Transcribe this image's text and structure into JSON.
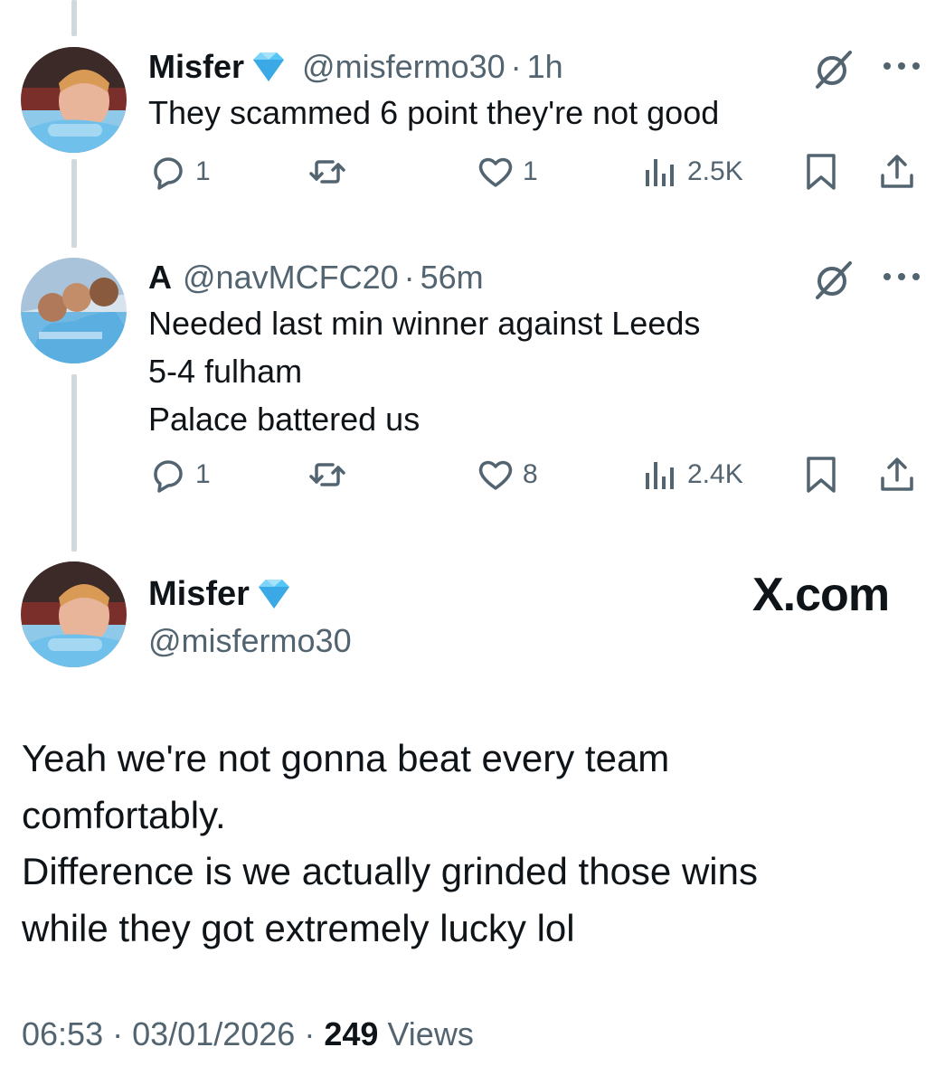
{
  "replies": [
    {
      "display_name": "Misfer",
      "verified_icon": "blue-diamond-emoji",
      "handle": "@misfermo30",
      "time": "1h",
      "text_lines": [
        "They scammed 6 point they're not good"
      ],
      "replies_count": "1",
      "reposts_count": "",
      "likes_count": "1",
      "views_count": "2.5K"
    },
    {
      "display_name": "A",
      "handle": "@navMCFC20",
      "time": "56m",
      "text_lines": [
        "Needed last min winner against Leeds",
        "5-4 fulham",
        "Palace battered us"
      ],
      "replies_count": "1",
      "reposts_count": "",
      "likes_count": "8",
      "views_count": "2.4K"
    }
  ],
  "main_post": {
    "display_name": "Misfer",
    "verified_icon": "blue-diamond-emoji",
    "handle": "@misfermo30",
    "watermark": "X.com",
    "text_lines": [
      "Yeah we're not gonna beat every team",
      "comfortably.",
      "Difference is we actually grinded those wins",
      "while they got extremely lucky lol"
    ],
    "time": "06:53",
    "date": "03/01/2026",
    "views_count": "249",
    "views_label": "Views",
    "separator": "·"
  },
  "colors": {
    "text": "#0f1419",
    "secondary": "#536471",
    "thread_line": "#cfd9de",
    "diamond": "#55c6f5"
  },
  "icons": [
    "reply-icon",
    "repost-icon",
    "like-icon",
    "views-icon",
    "bookmark-icon",
    "share-icon",
    "grok-icon",
    "more-icon"
  ]
}
